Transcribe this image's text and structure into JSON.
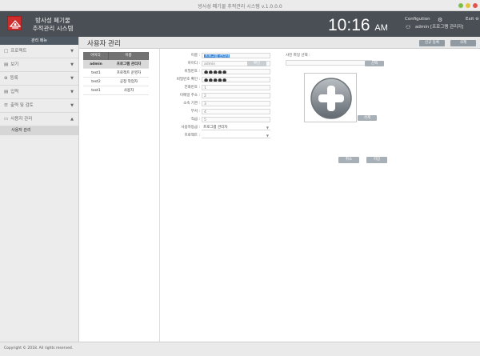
{
  "window": {
    "title": "방사성 폐기물 추적관리 시스템 v.1.0.0.0",
    "colors": {
      "close": "#e3524b",
      "minimize": "#e8c13d",
      "maximize": "#7bbf4b"
    }
  },
  "header": {
    "app_name_line1": "방사성 폐기물",
    "app_name_line2": "추적관리 시스템",
    "time": "10:16",
    "ampm": "AM",
    "configuration": "Configution",
    "configuration_icon": "gear-icon",
    "exit": "Exit",
    "user": "admin [프로그램 관리자]",
    "user_icon": "user-icon",
    "background": "#4a4f55"
  },
  "sidebar": {
    "title": "관리 메뉴",
    "items": [
      {
        "icon": "□",
        "label": "프로젝트",
        "chevron": "▼"
      },
      {
        "icon": "▤",
        "label": "보기",
        "chevron": "▼"
      },
      {
        "icon": "⊕",
        "label": "등록",
        "chevron": "▼"
      },
      {
        "icon": "▤",
        "label": "입력",
        "chevron": "▼"
      },
      {
        "icon": "☰",
        "label": "출력 및 검토",
        "chevron": "▼"
      },
      {
        "icon": "▭",
        "label": "사용자 관리",
        "chevron": "▲"
      }
    ],
    "active_sub": "사용자 관리"
  },
  "subheader": {
    "page_title": "사용자 관리",
    "new_button": "신규 등록",
    "delete_button": "삭제"
  },
  "user_list": {
    "columns": [
      "아이디",
      "이름"
    ],
    "rows": [
      {
        "id": "admin",
        "name": "프로그램 관리자",
        "selected": true
      },
      {
        "id": "test1",
        "name": "프로젝트 운영자",
        "selected": false
      },
      {
        "id": "test2",
        "name": "공정 작업자",
        "selected": false
      },
      {
        "id": "test1",
        "name": "사용자",
        "selected": false
      }
    ]
  },
  "form": {
    "name_label": "이름 :",
    "name_value": "프로그램 관리자",
    "id_label": "아이디 :",
    "id_value": "admin",
    "check_button": "확인",
    "password_label": "비밀번호 :",
    "password_value": "●●●●●",
    "password_confirm_label": "비밀번호 확인 :",
    "password_confirm_value": "●●●●●",
    "phone_label": "전화번호 :",
    "phone_value": "1",
    "email_label": "이메일 주소 :",
    "email_value": "2",
    "org_label": "소속 기관 :",
    "org_value": "3",
    "dept_label": "부서 :",
    "dept_value": "4",
    "position_label": "직급 :",
    "position_value": "5",
    "level_label": "사용자등급 :",
    "level_value": "프로그램 관리자",
    "project_label": "프로젝트 :",
    "project_value": ""
  },
  "photo": {
    "label": "사진 파일 선택 :",
    "select_button": "선택",
    "delete_button": "삭제",
    "placeholder_icon": "add-photo-icon"
  },
  "actions": {
    "cancel": "취소",
    "save": "저장"
  },
  "footer": {
    "copyright": "Copyright © 2018. All rights reserved."
  }
}
